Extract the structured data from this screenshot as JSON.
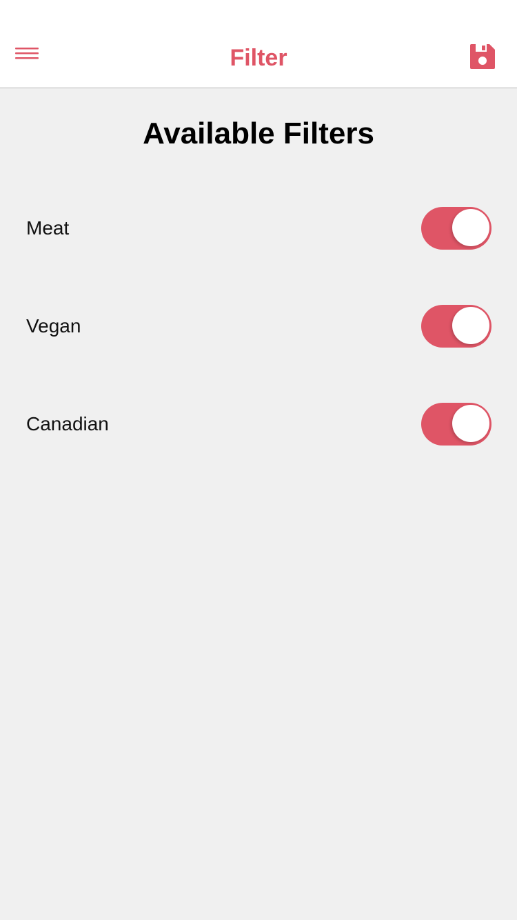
{
  "colors": {
    "accent": "#df5566",
    "background": "#f0f0f0",
    "header_background": "#ffffff"
  },
  "header": {
    "title": "Filter",
    "menu_icon": "hamburger-menu-icon",
    "save_icon": "floppy-disk-icon"
  },
  "main": {
    "section_title": "Available Filters",
    "filters": [
      {
        "label": "Meat",
        "enabled": true
      },
      {
        "label": "Vegan",
        "enabled": true
      },
      {
        "label": "Canadian",
        "enabled": true
      }
    ]
  }
}
